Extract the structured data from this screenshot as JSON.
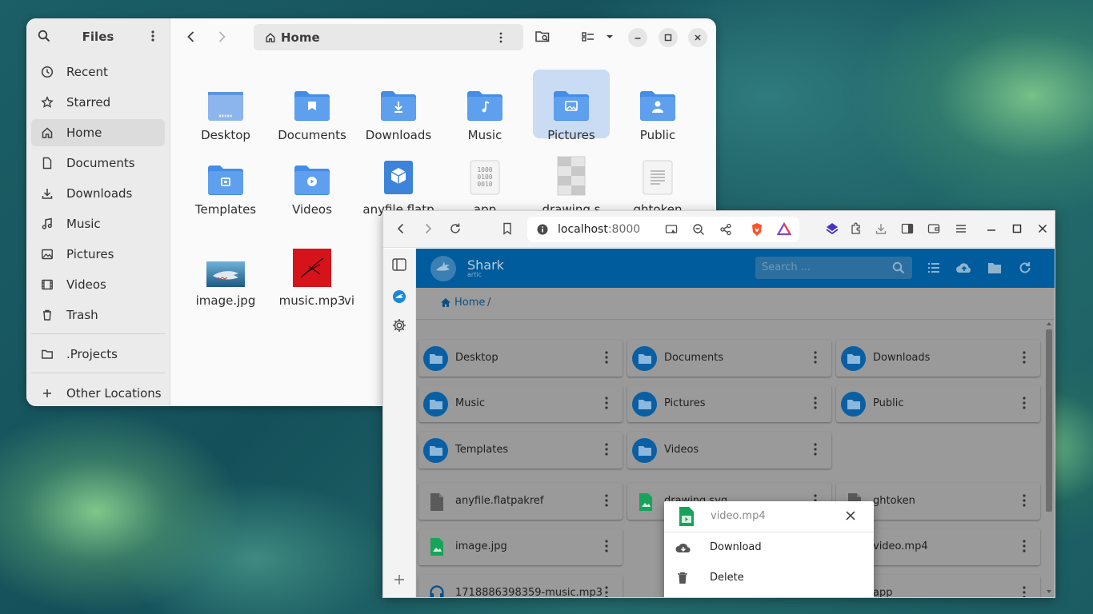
{
  "files": {
    "title": "Files",
    "sidebar": {
      "items": [
        {
          "label": "Recent",
          "icon": "clock-icon"
        },
        {
          "label": "Starred",
          "icon": "star-icon"
        },
        {
          "label": "Home",
          "icon": "home-icon",
          "active": true
        },
        {
          "label": "Documents",
          "icon": "document-icon"
        },
        {
          "label": "Downloads",
          "icon": "download-icon"
        },
        {
          "label": "Music",
          "icon": "music-icon"
        },
        {
          "label": "Pictures",
          "icon": "picture-icon"
        },
        {
          "label": "Videos",
          "icon": "video-icon"
        },
        {
          "label": "Trash",
          "icon": "trash-icon"
        }
      ],
      "bookmarks": [
        {
          "label": ".Projects",
          "icon": "folder-icon"
        }
      ],
      "other_locations": "Other Locations"
    },
    "path": "Home",
    "grid": [
      {
        "label": "Desktop",
        "type": "folder-desktop"
      },
      {
        "label": "Documents",
        "type": "folder-documents"
      },
      {
        "label": "Downloads",
        "type": "folder-downloads"
      },
      {
        "label": "Music",
        "type": "folder-music"
      },
      {
        "label": "Pictures",
        "type": "folder-pictures",
        "selected": true
      },
      {
        "label": "Public",
        "type": "folder-public"
      },
      {
        "label": "Templates",
        "type": "folder-templates"
      },
      {
        "label": "Videos",
        "type": "folder-videos"
      },
      {
        "label": "anyfile.flatp",
        "type": "flatpak"
      },
      {
        "label": "app",
        "type": "binary"
      },
      {
        "label": "drawing.s",
        "type": "svg"
      },
      {
        "label": "ghtoken",
        "type": "text"
      },
      {
        "label": "image.jpg",
        "type": "image"
      },
      {
        "label": "music.mp3",
        "type": "audio"
      },
      {
        "label": "vi",
        "type": "video"
      }
    ]
  },
  "browser": {
    "url_host": "localhost",
    "url_port": ":8000",
    "app": {
      "name": "Shark",
      "subtitle": "artic",
      "search_placeholder": "Search ...",
      "breadcrumb_home": "Home",
      "breadcrumb_sep": "/"
    },
    "folders": [
      "Desktop",
      "Documents",
      "Downloads",
      "Music",
      "Pictures",
      "Public",
      "Templates",
      "Videos"
    ],
    "files": [
      {
        "name": "anyfile.flatpakref",
        "kind": "generic"
      },
      {
        "name": "drawing.svg",
        "kind": "image"
      },
      {
        "name": "ghtoken",
        "kind": "generic"
      },
      {
        "name": "image.jpg",
        "kind": "image"
      },
      {
        "name": "",
        "kind": "hidden"
      },
      {
        "name": "video.mp4",
        "kind": "video"
      },
      {
        "name": "1718886398359-music.mp3",
        "kind": "audio"
      },
      {
        "name": "",
        "kind": "hidden"
      },
      {
        "name": "app",
        "kind": "generic"
      }
    ],
    "popup": {
      "file": "video.mp4",
      "actions": [
        {
          "label": "Download",
          "icon": "cloud-download-icon"
        },
        {
          "label": "Delete",
          "icon": "trash-icon"
        }
      ]
    },
    "colors": {
      "header": "#005c9c",
      "folder": "#0a5fa3",
      "accent": "#3584e4"
    }
  }
}
